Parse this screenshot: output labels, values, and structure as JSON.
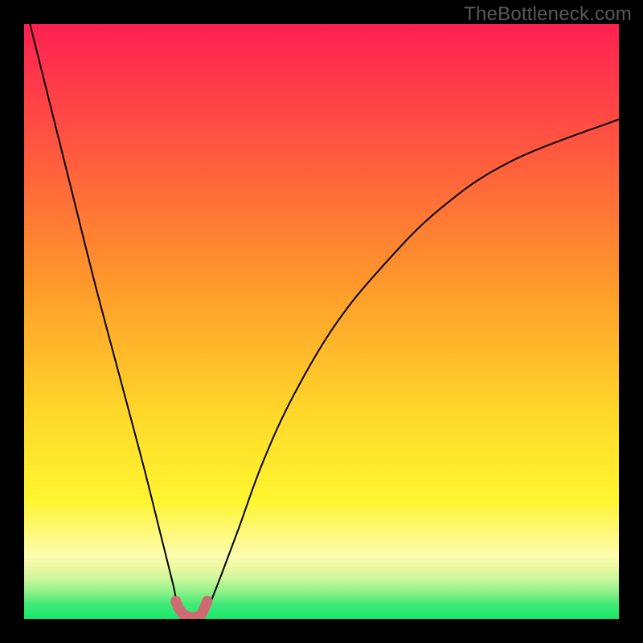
{
  "watermark": {
    "text": "TheBottleneck.com"
  },
  "colors": {
    "black": "#000000",
    "curve": "#000000",
    "bottom_marker": "#cf6a72",
    "green": "#17e86a",
    "light_green": "#b7f6a3",
    "yellow": "#fff530",
    "orange": "#ff8e2b",
    "red_orange": "#ff5a3e",
    "pink_red": "#ff2052"
  },
  "chart_data": {
    "type": "line",
    "title": "",
    "xlabel": "",
    "ylabel": "",
    "xlim": [
      0,
      100
    ],
    "ylim": [
      0,
      100
    ],
    "notes": "Bottleneck-style V curve. Minimum (optimal region) around x≈26–31. Left branch steep, right branch shallow and asymptotic toward ~y=84 at x=100.",
    "series": [
      {
        "name": "bottleneck-curve",
        "x": [
          1,
          4,
          8,
          12,
          16,
          20,
          23,
          25,
          26,
          28,
          30,
          31,
          33,
          36,
          40,
          45,
          52,
          60,
          70,
          82,
          100
        ],
        "y": [
          100,
          88,
          72,
          56,
          41,
          26,
          14,
          6,
          2,
          0.5,
          0.5,
          2,
          7,
          15,
          26,
          37,
          49,
          59,
          69,
          77,
          84
        ]
      },
      {
        "name": "optimal-region-overlay",
        "x": [
          25.5,
          26.0,
          26.8,
          28.0,
          29.0,
          29.8,
          30.3,
          30.8
        ],
        "y": [
          3.0,
          1.8,
          0.8,
          0.3,
          0.3,
          0.8,
          1.8,
          3.0
        ]
      }
    ],
    "gradient_stops": [
      {
        "offset": 0.0,
        "color": "#ff2052"
      },
      {
        "offset": 0.22,
        "color": "#ff5a3e"
      },
      {
        "offset": 0.44,
        "color": "#ff9a2b"
      },
      {
        "offset": 0.66,
        "color": "#ffd92a"
      },
      {
        "offset": 0.8,
        "color": "#fff530"
      },
      {
        "offset": 0.895,
        "color": "#fdfcb0"
      },
      {
        "offset": 0.915,
        "color": "#e9f9a0"
      },
      {
        "offset": 0.935,
        "color": "#c6f59a"
      },
      {
        "offset": 0.955,
        "color": "#8ef089"
      },
      {
        "offset": 0.975,
        "color": "#42ea77"
      },
      {
        "offset": 1.0,
        "color": "#17e86a"
      }
    ]
  }
}
